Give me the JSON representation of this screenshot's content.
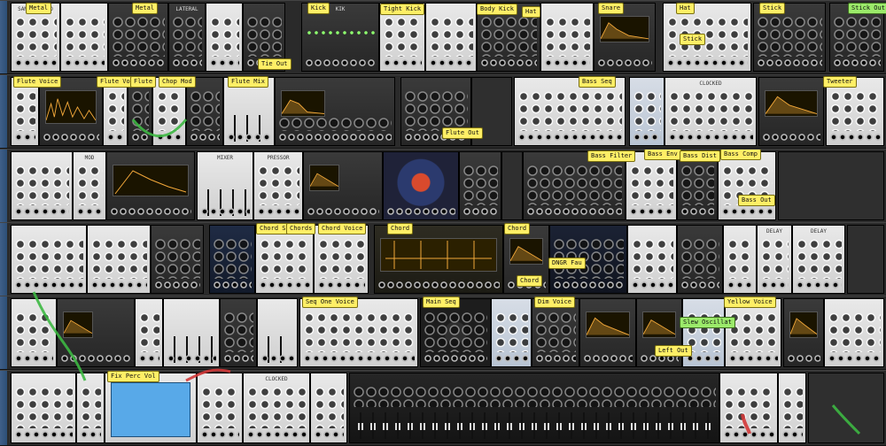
{
  "labels": {
    "row1": [
      {
        "text": "Metal"
      },
      {
        "text": "Metal"
      },
      {
        "text": "Kick"
      },
      {
        "text": "Tight Kick"
      },
      {
        "text": "Body Kick"
      },
      {
        "text": "Hat"
      },
      {
        "text": "Snare"
      },
      {
        "text": "Hat"
      },
      {
        "text": "Stick"
      },
      {
        "text": "Stick Out"
      },
      {
        "text": "Stick"
      },
      {
        "text": "Tie Out"
      }
    ],
    "row2": [
      {
        "text": "Flute Voice"
      },
      {
        "text": "Flute Voice"
      },
      {
        "text": "Flute"
      },
      {
        "text": "Chop Mod"
      },
      {
        "text": "Flute Mix"
      },
      {
        "text": "Flute Out"
      },
      {
        "text": "Bass Seq"
      },
      {
        "text": "Tweeter"
      }
    ],
    "row3": [
      {
        "text": "Bass Filter"
      },
      {
        "text": "Bass Env"
      },
      {
        "text": "Bass Dist"
      },
      {
        "text": "Bass Comp"
      },
      {
        "text": "Bass Out"
      }
    ],
    "row4": [
      {
        "text": "Chord Seq"
      },
      {
        "text": "Chords"
      },
      {
        "text": "Chord Voice"
      },
      {
        "text": "Chord"
      },
      {
        "text": "Chord"
      },
      {
        "text": "Chord"
      },
      {
        "text": "DNGR Fau"
      }
    ],
    "row5": [
      {
        "text": "Seq One Voice"
      },
      {
        "text": "Main Seq"
      },
      {
        "text": "Dim Voice"
      },
      {
        "text": "Yellow Voice"
      },
      {
        "text": "Left Out"
      },
      {
        "text": "Slew Oscillat"
      }
    ],
    "row6": [
      {
        "text": "Fix Perc Vol"
      }
    ]
  },
  "module_headers": {
    "r1": [
      "SAMPLEFIELD",
      "",
      "MEGA",
      "",
      "STEREO",
      "LATERAL",
      "",
      "",
      "",
      "",
      "KIK",
      "",
      "",
      "",
      "",
      "",
      "",
      "",
      "",
      "",
      "",
      "",
      ""
    ],
    "r2": [
      "",
      "",
      "",
      "",
      "",
      "",
      "",
      "",
      "",
      "",
      "",
      "",
      "",
      "",
      "",
      "",
      "CLOCKED",
      "",
      ""
    ],
    "r3": [
      "MOD",
      "",
      "",
      "MIXER",
      "PRESSOR",
      "",
      "",
      "",
      "",
      "",
      "",
      "",
      "",
      "",
      "",
      ""
    ],
    "r4": [
      "",
      "",
      "",
      "",
      "",
      "",
      "",
      "",
      "",
      "",
      "",
      "",
      "",
      "DELAY",
      "DELAY",
      ""
    ],
    "r5": [
      "",
      "",
      "",
      "",
      "",
      "",
      "",
      "",
      "",
      "",
      "",
      "",
      "",
      "",
      "",
      ""
    ],
    "r6": [
      "",
      "",
      "",
      "",
      "",
      "",
      "",
      "",
      "CLOCKED",
      "",
      "",
      "",
      "",
      "",
      ""
    ]
  },
  "colors": {
    "tag_yellow": "#ffef66",
    "tag_green": "#9bea6a",
    "rail_blue": "#3f5f88",
    "scope_amber": "#f2a83a",
    "screen_blue": "#58a9e8"
  },
  "icons": {
    "knob": "knob-icon",
    "jack": "jack-icon",
    "led": "led-icon"
  }
}
